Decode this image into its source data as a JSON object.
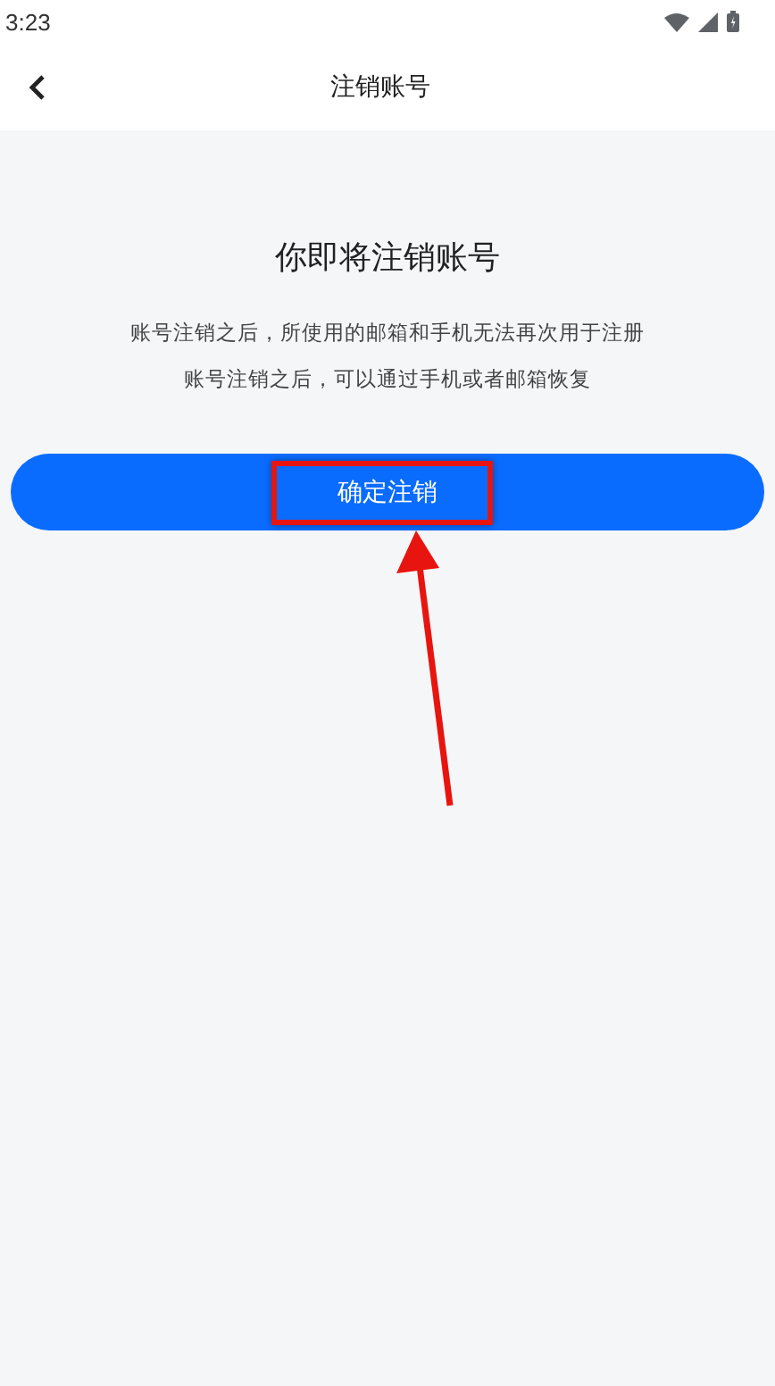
{
  "status_bar": {
    "time": "3:23"
  },
  "nav": {
    "title": "注销账号"
  },
  "heading": "你即将注销账号",
  "notes": [
    "账号注销之后，所使用的邮箱和手机无法再次用于注册",
    "账号注销之后，可以通过手机或者邮箱恢复"
  ],
  "button": {
    "label": "确定注销"
  }
}
